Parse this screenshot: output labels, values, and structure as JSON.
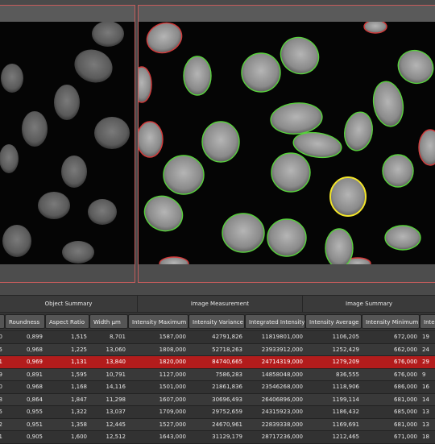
{
  "table": {
    "groups": [
      "Object Summary",
      "Image Measurement",
      "Image Summary"
    ],
    "columns": [
      "Roundness",
      "Aspect Ratio",
      "Width µm",
      "Intensity Maximum",
      "Intensity Variance",
      "Integrated Intensity",
      "Intensity Average",
      "Intensity Minimum",
      "Inte"
    ],
    "rows": [
      {
        "cells": [
          "0",
          "0,899",
          "1,515",
          "8,701",
          "1587,000",
          "42791,826",
          "11819801,000",
          "1106,205",
          "672,000",
          "19"
        ],
        "selected": false
      },
      {
        "cells": [
          "5",
          "0,968",
          "1,225",
          "13,060",
          "1808,000",
          "52718,263",
          "23933912,000",
          "1252,429",
          "662,000",
          "24"
        ],
        "selected": false
      },
      {
        "cells": [
          "1",
          "0,969",
          "1,131",
          "13,840",
          "1820,000",
          "84740,665",
          "24714319,000",
          "1279,209",
          "676,000",
          "29"
        ],
        "selected": true
      },
      {
        "cells": [
          "9",
          "0,891",
          "1,595",
          "10,791",
          "1127,000",
          "7586,283",
          "14858048,000",
          "836,555",
          "676,000",
          "9"
        ],
        "selected": false
      },
      {
        "cells": [
          "0",
          "0,968",
          "1,168",
          "14,116",
          "1501,000",
          "21861,836",
          "23546268,000",
          "1118,906",
          "686,000",
          "16"
        ],
        "selected": false
      },
      {
        "cells": [
          "8",
          "0,864",
          "1,847",
          "11,298",
          "1607,000",
          "30696,493",
          "26406896,000",
          "1199,114",
          "681,000",
          "14"
        ],
        "selected": false
      },
      {
        "cells": [
          "5",
          "0,955",
          "1,322",
          "13,037",
          "1709,000",
          "29752,659",
          "24315923,000",
          "1186,432",
          "685,000",
          "13"
        ],
        "selected": false
      },
      {
        "cells": [
          "2",
          "0,951",
          "1,358",
          "12,445",
          "1527,000",
          "24670,961",
          "22839338,000",
          "1169,691",
          "681,000",
          "13"
        ],
        "selected": false
      },
      {
        "cells": [
          "1",
          "0,905",
          "1,600",
          "12,512",
          "1643,000",
          "31129,179",
          "28717236,000",
          "1212,465",
          "671,000",
          "18"
        ],
        "selected": false
      }
    ]
  }
}
